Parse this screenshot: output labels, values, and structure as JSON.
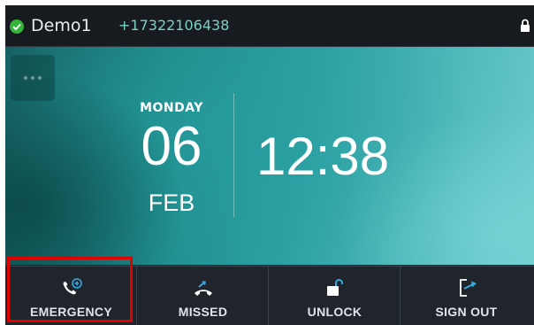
{
  "status": {
    "account": "Demo1",
    "number": "+17322106438",
    "registered_icon": "check-circle-icon",
    "lock_icon": "lock-icon"
  },
  "clock": {
    "weekday": "MONDAY",
    "day": "06",
    "month": "FEB",
    "time": "12:38"
  },
  "more_button": {
    "icon": "more-dots-icon"
  },
  "softkeys": [
    {
      "label": "EMERGENCY",
      "icon": "emergency-call-icon"
    },
    {
      "label": "MISSED",
      "icon": "missed-call-icon"
    },
    {
      "label": "UNLOCK",
      "icon": "unlock-icon"
    },
    {
      "label": "SIGN OUT",
      "icon": "sign-out-icon"
    }
  ],
  "colors": {
    "accent": "#35a8e0",
    "registered": "#35b43a",
    "highlight": "#e10000"
  }
}
